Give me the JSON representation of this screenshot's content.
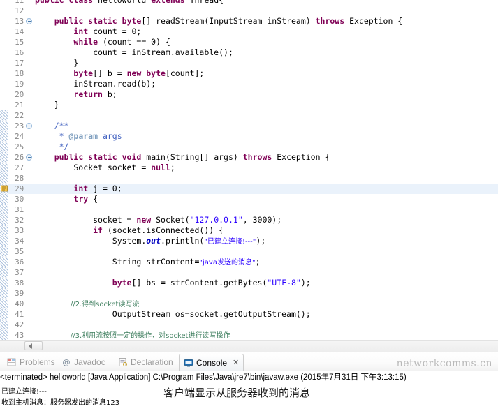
{
  "editor": {
    "lines": [
      {
        "n": "11",
        "fold": false,
        "indent": 1,
        "clipped": true,
        "segs": [
          {
            "t": "public ",
            "c": "kw"
          },
          {
            "t": "class ",
            "c": "kw"
          },
          {
            "t": "helloworld ",
            "c": "plain"
          },
          {
            "t": "extends ",
            "c": "kw"
          },
          {
            "t": "Thread{",
            "c": "plain"
          }
        ]
      },
      {
        "n": "12",
        "segs": []
      },
      {
        "n": "13",
        "fold": true,
        "segs": [
          {
            "t": "    ",
            "c": "plain"
          },
          {
            "t": "public static ",
            "c": "kw"
          },
          {
            "t": "byte",
            "c": "kw"
          },
          {
            "t": "[] readStream(InputStream inStream) ",
            "c": "plain"
          },
          {
            "t": "throws ",
            "c": "kw"
          },
          {
            "t": "Exception {",
            "c": "plain"
          }
        ]
      },
      {
        "n": "14",
        "segs": [
          {
            "t": "        ",
            "c": "plain"
          },
          {
            "t": "int ",
            "c": "kw"
          },
          {
            "t": "count = 0;",
            "c": "plain"
          }
        ]
      },
      {
        "n": "15",
        "segs": [
          {
            "t": "        ",
            "c": "plain"
          },
          {
            "t": "while ",
            "c": "kw"
          },
          {
            "t": "(count == 0) {",
            "c": "plain"
          }
        ]
      },
      {
        "n": "16",
        "segs": [
          {
            "t": "            count = inStream.available();",
            "c": "plain"
          }
        ]
      },
      {
        "n": "17",
        "segs": [
          {
            "t": "        }",
            "c": "plain"
          }
        ]
      },
      {
        "n": "18",
        "segs": [
          {
            "t": "        ",
            "c": "plain"
          },
          {
            "t": "byte",
            "c": "kw"
          },
          {
            "t": "[] b = ",
            "c": "plain"
          },
          {
            "t": "new byte",
            "c": "kw"
          },
          {
            "t": "[count];",
            "c": "plain"
          }
        ]
      },
      {
        "n": "19",
        "segs": [
          {
            "t": "        inStream.read(b);",
            "c": "plain"
          }
        ]
      },
      {
        "n": "20",
        "segs": [
          {
            "t": "        ",
            "c": "plain"
          },
          {
            "t": "return ",
            "c": "kw"
          },
          {
            "t": "b;",
            "c": "plain"
          }
        ]
      },
      {
        "n": "21",
        "segs": [
          {
            "t": "    }",
            "c": "plain"
          }
        ]
      },
      {
        "n": "22",
        "segs": []
      },
      {
        "n": "23",
        "fold": true,
        "segs": [
          {
            "t": "    /**",
            "c": "jdoc"
          }
        ]
      },
      {
        "n": "24",
        "segs": [
          {
            "t": "     * ",
            "c": "jdoc"
          },
          {
            "t": "@param",
            "c": "jdoc-tag"
          },
          {
            "t": " args",
            "c": "jdoc"
          }
        ]
      },
      {
        "n": "25",
        "segs": [
          {
            "t": "     */",
            "c": "jdoc"
          }
        ]
      },
      {
        "n": "26",
        "fold": true,
        "segs": [
          {
            "t": "    ",
            "c": "plain"
          },
          {
            "t": "public static void ",
            "c": "kw"
          },
          {
            "t": "main(String[] args) ",
            "c": "plain"
          },
          {
            "t": "throws ",
            "c": "kw"
          },
          {
            "t": "Exception {",
            "c": "plain"
          }
        ]
      },
      {
        "n": "27",
        "segs": [
          {
            "t": "        Socket socket = ",
            "c": "plain"
          },
          {
            "t": "null",
            "c": "kw"
          },
          {
            "t": ";",
            "c": "plain"
          }
        ]
      },
      {
        "n": "28",
        "segs": []
      },
      {
        "n": "29",
        "highlight": true,
        "breakpoint": true,
        "caret": true,
        "segs": [
          {
            "t": "        ",
            "c": "plain"
          },
          {
            "t": "int ",
            "c": "kw"
          },
          {
            "t": "j = 0;",
            "c": "plain"
          }
        ]
      },
      {
        "n": "30",
        "segs": [
          {
            "t": "        ",
            "c": "plain"
          },
          {
            "t": "try ",
            "c": "kw"
          },
          {
            "t": "{",
            "c": "plain"
          }
        ]
      },
      {
        "n": "31",
        "segs": []
      },
      {
        "n": "32",
        "segs": [
          {
            "t": "            socket = ",
            "c": "plain"
          },
          {
            "t": "new ",
            "c": "kw"
          },
          {
            "t": "Socket(",
            "c": "plain"
          },
          {
            "t": "\"127.0.0.1\"",
            "c": "str"
          },
          {
            "t": ", 3000);",
            "c": "plain"
          }
        ]
      },
      {
        "n": "33",
        "segs": [
          {
            "t": "            ",
            "c": "plain"
          },
          {
            "t": "if ",
            "c": "kw"
          },
          {
            "t": "(socket.isConnected()) {",
            "c": "plain"
          }
        ]
      },
      {
        "n": "34",
        "segs": [
          {
            "t": "                System.",
            "c": "plain"
          },
          {
            "t": "out",
            "c": "fld"
          },
          {
            "t": ".println(",
            "c": "plain"
          },
          {
            "t": "\"已建立连接!---\"",
            "c": "str-cn"
          },
          {
            "t": ");",
            "c": "plain"
          }
        ]
      },
      {
        "n": "35",
        "segs": []
      },
      {
        "n": "36",
        "segs": [
          {
            "t": "                String strContent=",
            "c": "plain"
          },
          {
            "t": "\"java发送的消息\"",
            "c": "str-cn"
          },
          {
            "t": ";",
            "c": "plain"
          }
        ]
      },
      {
        "n": "37",
        "segs": []
      },
      {
        "n": "38",
        "segs": [
          {
            "t": "                ",
            "c": "plain"
          },
          {
            "t": "byte",
            "c": "kw"
          },
          {
            "t": "[] bs = strContent.getBytes(",
            "c": "plain"
          },
          {
            "t": "\"UTF-8\"",
            "c": "str"
          },
          {
            "t": ");",
            "c": "plain"
          }
        ]
      },
      {
        "n": "39",
        "segs": []
      },
      {
        "n": "40",
        "segs": [
          {
            "t": "                //2.得到socket读写流",
            "c": "cmt-cn"
          }
        ]
      },
      {
        "n": "41",
        "segs": [
          {
            "t": "                OutputStream os=socket.getOutputStream();",
            "c": "plain"
          }
        ]
      },
      {
        "n": "42",
        "segs": []
      },
      {
        "n": "43",
        "segs": [
          {
            "t": "                //3.利用流按照一定的操作，对socket进行读写操作",
            "c": "cmt-cn"
          }
        ]
      }
    ]
  },
  "bottom": {
    "tabs": [
      {
        "label": "Problems",
        "icon": "problems-icon",
        "active": false
      },
      {
        "label": "Javadoc",
        "icon": "javadoc-icon",
        "active": false
      },
      {
        "label": "Declaration",
        "icon": "declaration-icon",
        "active": false
      },
      {
        "label": "Console",
        "icon": "console-icon",
        "active": true,
        "close": "✕"
      }
    ],
    "watermark": "networkcomms.cn",
    "console_header": "<terminated> helloworld [Java Application] C:\\Program Files\\Java\\jre7\\bin\\javaw.exe (2015年7月31日 下午3:13:15)",
    "console_lines": [
      "已建立连接!---",
      "收到主机消息：服务器发出的消息123"
    ],
    "annotation": "客户端显示从服务器收到的消息"
  },
  "colors": {
    "keyword": "#7f0055",
    "string": "#2a00ff",
    "comment": "#3f7f5f",
    "javadoc": "#3f5fbf",
    "field": "#0000c0",
    "highlight_row": "#eaf2fb",
    "line_number": "#888888",
    "watermark": "#b9b9b9"
  }
}
